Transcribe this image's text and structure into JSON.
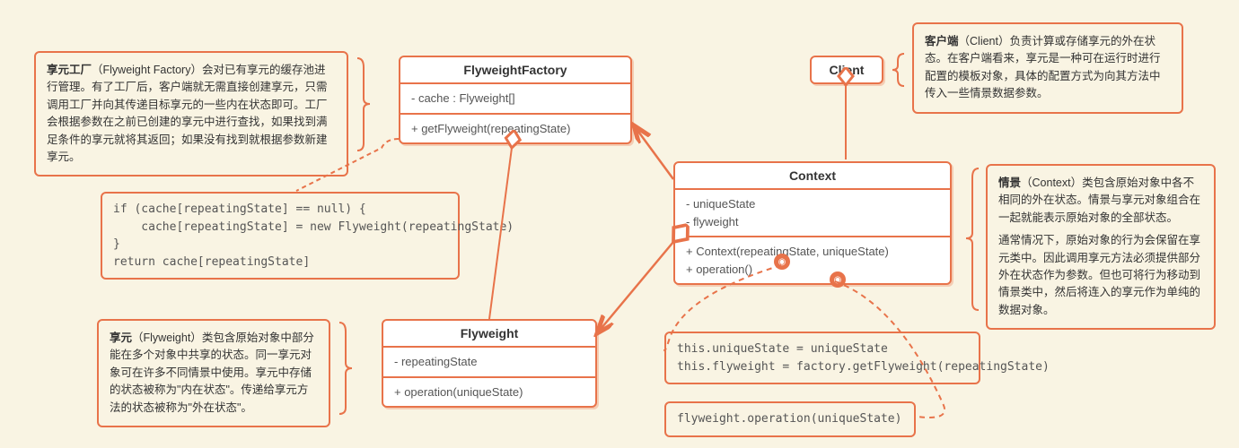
{
  "notes": {
    "factory": {
      "title": "享元工厂",
      "en": "（Flyweight Factory）",
      "body": "会对已有享元的缓存池进行管理。有了工厂后，客户端就无需直接创建享元，只需调用工厂并向其传递目标享元的一些内在状态即可。工厂会根据参数在之前已创建的享元中进行查找，如果找到满足条件的享元就将其返回；如果没有找到就根据参数新建享元。"
    },
    "flyweight": {
      "title": "享元",
      "en": "（Flyweight）",
      "body": "类包含原始对象中部分能在多个对象中共享的状态。同一享元对象可在许多不同情景中使用。享元中存储的状态被称为\"内在状态\"。传递给享元方法的状态被称为\"外在状态\"。"
    },
    "client": {
      "title": "客户端",
      "en": "（Client）",
      "body": "负责计算或存储享元的外在状态。在客户端看来，享元是一种可在运行时进行配置的模板对象，具体的配置方式为向其方法中传入一些情景数据参数。"
    },
    "context": {
      "title": "情景",
      "en": "（Context）",
      "body1": "类包含原始对象中各不相同的外在状态。情景与享元对象组合在一起就能表示原始对象的全部状态。",
      "body2": "通常情况下，原始对象的行为会保留在享元类中。因此调用享元方法必须提供部分外在状态作为参数。但也可将行为移动到情景类中，然后将连入的享元作为单纯的数据对象。"
    }
  },
  "classes": {
    "factory": {
      "name": "FlyweightFactory",
      "fields": "- cache : Flyweight[]",
      "methods": "+ getFlyweight(repeatingState)"
    },
    "client": {
      "name": "Client"
    },
    "context": {
      "name": "Context",
      "fields": "- uniqueState\n- flyweight",
      "methods": "+ Context(repeatingState, uniqueState)\n+ operation()"
    },
    "flyweight": {
      "name": "Flyweight",
      "fields": "- repeatingState",
      "methods": "+ operation(uniqueState)"
    }
  },
  "code": {
    "getFlyweight": "if (cache[repeatingState] == null) {\n    cache[repeatingState] = new Flyweight(repeatingState)\n}\nreturn cache[repeatingState]",
    "contextCtor": "this.uniqueState = uniqueState\nthis.flyweight = factory.getFlyweight(repeatingState)",
    "operation": "flyweight.operation(uniqueState)"
  }
}
